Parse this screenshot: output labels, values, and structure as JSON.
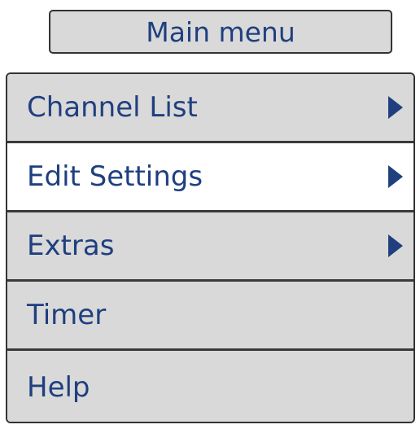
{
  "title": "Main menu",
  "menu": {
    "items": [
      {
        "label": "Channel List",
        "has_submenu": true,
        "selected": false
      },
      {
        "label": "Edit Settings",
        "has_submenu": true,
        "selected": true
      },
      {
        "label": "Extras",
        "has_submenu": true,
        "selected": false
      },
      {
        "label": "Timer",
        "has_submenu": false,
        "selected": false
      },
      {
        "label": "Help",
        "has_submenu": false,
        "selected": false
      }
    ]
  },
  "icons": {
    "submenu_arrow": "chevron-right-icon"
  },
  "colors": {
    "text": "#1f3f7f",
    "item_background": "#d9d9d9",
    "selected_background": "#ffffff",
    "border": "#333333"
  }
}
